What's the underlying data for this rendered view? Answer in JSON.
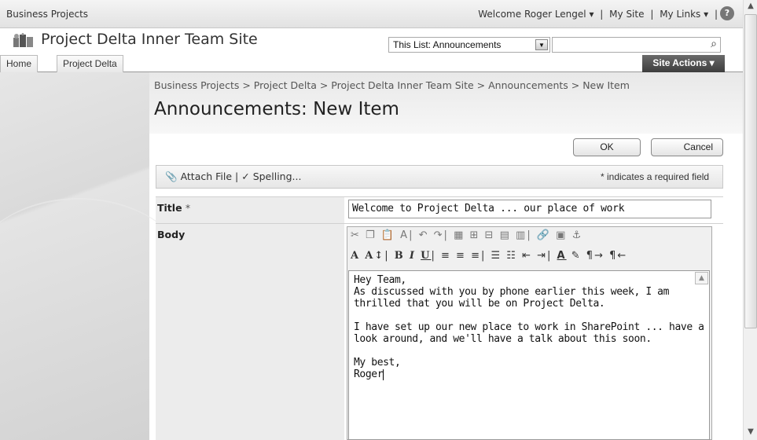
{
  "topbar": {
    "site_link": "Business Projects",
    "welcome": "Welcome Roger Lengel ▾",
    "my_site": "My Site",
    "my_links": "My Links ▾"
  },
  "header": {
    "site_title": "Project Delta Inner Team Site",
    "search_scope": "This List: Announcements",
    "search_value": ""
  },
  "nav": {
    "tabs": [
      "Home",
      "Project Delta"
    ],
    "site_actions": "Site Actions ▾"
  },
  "page": {
    "breadcrumb": "Business Projects > Project Delta > Project Delta Inner Team Site > Announcements > New Item",
    "title": "Announcements: New Item"
  },
  "buttons": {
    "ok": "OK",
    "cancel": "Cancel"
  },
  "toolbar": {
    "attach_file": "Attach File",
    "spelling": "Spelling...",
    "required_note": "* indicates a required field"
  },
  "form": {
    "title_label": "Title",
    "title_required": "*",
    "title_value": "Welcome to Project Delta ... our place of work",
    "body_label": "Body",
    "body_text": "Hey Team,\nAs discussed with you by phone earlier this week, I am\nthrilled that you will be on Project Delta.\n\nI have set up our new place to work in SharePoint ... have a\nlook around, and we'll have a talk about this soon.\n\nMy best,\nRoger"
  },
  "editor": {
    "row1_icons": [
      "cut-icon",
      "copy-icon",
      "paste-icon",
      "format-painter-icon",
      "undo-icon",
      "redo-icon",
      "table-icon",
      "insert-row-icon",
      "insert-column-icon",
      "merge-cells-icon",
      "split-cells-icon",
      "link-icon",
      "image-icon",
      "anchor-icon"
    ],
    "row2_icons": [
      "font-icon",
      "font-size-icon",
      "bold-icon",
      "italic-icon",
      "underline-icon",
      "align-left-icon",
      "align-center-icon",
      "align-right-icon",
      "numbered-list-icon",
      "bullet-list-icon",
      "decrease-indent-icon",
      "increase-indent-icon",
      "text-color-icon",
      "highlight-icon",
      "ltr-icon",
      "rtl-icon"
    ]
  }
}
